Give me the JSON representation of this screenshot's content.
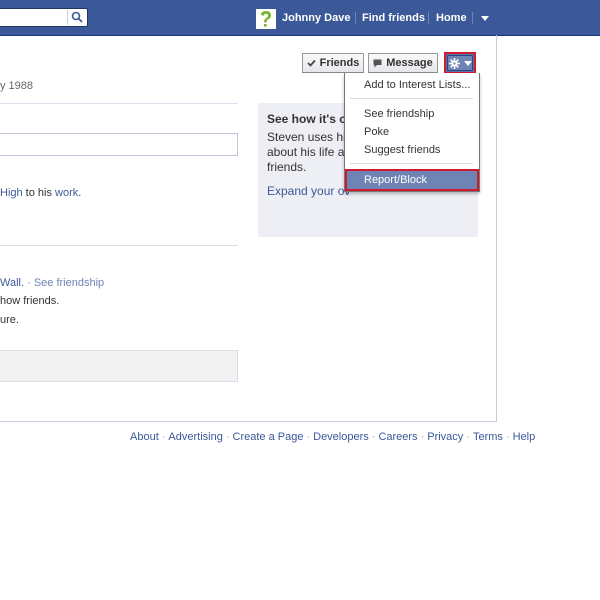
{
  "topbar": {
    "user_name": "Johnny Dave",
    "find_friends": "Find friends",
    "home": "Home"
  },
  "profile": {
    "birthday_fragment": "y 1988",
    "work_line": {
      "link1": "High",
      "text1": " to his ",
      "link2": "work",
      "text2": "."
    },
    "wall_line": {
      "link1": "Wall.",
      "sep": " · ",
      "link2": "See friendship"
    },
    "line_friends": "how friends.",
    "line_future": "ure."
  },
  "actions": {
    "friends_label": "Friends",
    "message_label": "Message"
  },
  "dropdown": {
    "items": [
      "Add to Interest Lists...",
      "See friendship",
      "Poke",
      "Suggest friends"
    ],
    "report_block": "Report/Block"
  },
  "see_box": {
    "title": "See how it's c",
    "body": "Steven uses hi about his life a friends.",
    "expand": "Expand your ov"
  },
  "footer": {
    "links": [
      "About",
      "Advertising",
      "Create a Page",
      "Developers",
      "Careers",
      "Privacy",
      "Terms",
      "Help"
    ]
  },
  "colors": {
    "brand": "#3b5998",
    "highlight_border": "#d0182e"
  }
}
